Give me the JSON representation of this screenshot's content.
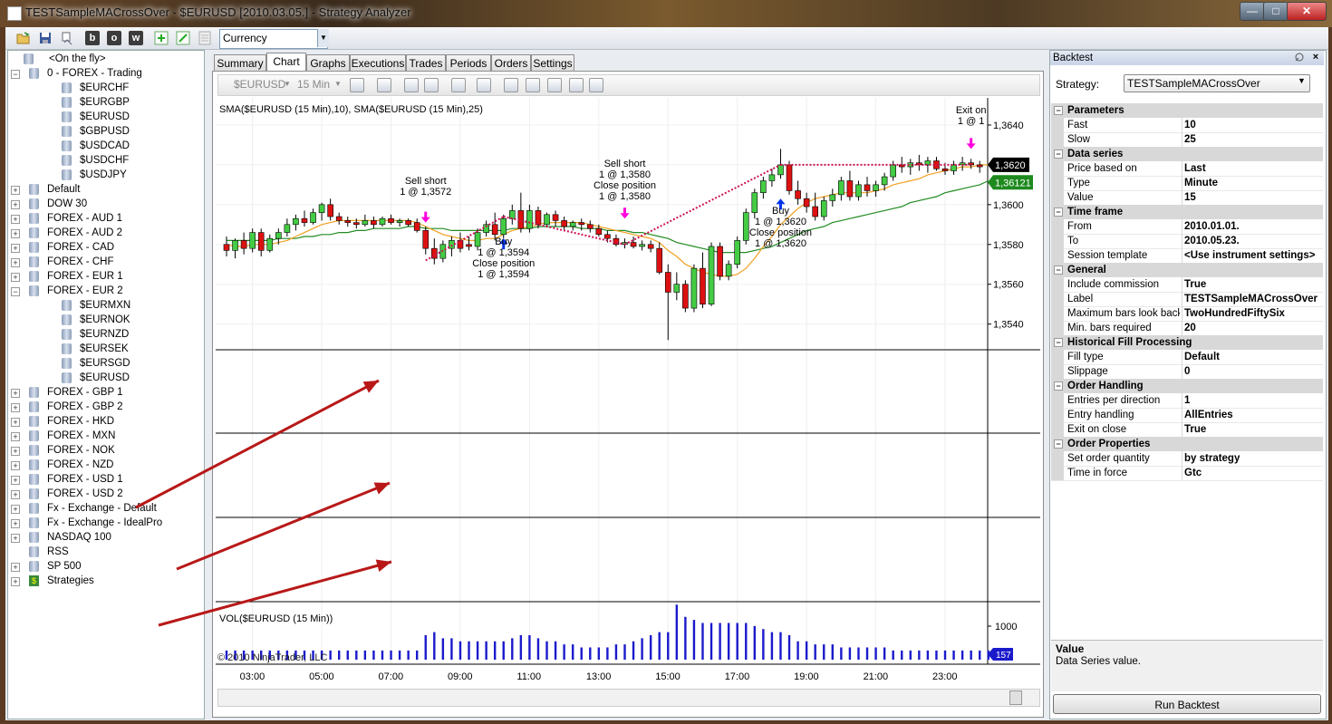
{
  "window": {
    "title": "TESTSampleMACrossOver - $EURUSD [2010.03.05.] - Strategy Analyzer",
    "min_glyph": "—",
    "max_glyph": "□",
    "close_glyph": "✕"
  },
  "toolbar": {
    "icons": [
      "folder-open-icon",
      "save-icon",
      "print-icon",
      "bold-b-icon",
      "bold-o-icon",
      "bold-w-icon",
      "add-icon",
      "edit-icon",
      "delete-icon"
    ],
    "letters": [
      "b",
      "o",
      "w"
    ],
    "currency_select": "Currency"
  },
  "tree": {
    "items": [
      {
        "label": "<On the fly>",
        "level": 1,
        "exp": ""
      },
      {
        "label": "0 - FOREX - Trading",
        "level": 0,
        "exp": "−"
      },
      {
        "label": "$EURCHF",
        "level": 2,
        "exp": ""
      },
      {
        "label": "$EURGBP",
        "level": 2,
        "exp": ""
      },
      {
        "label": "$EURUSD",
        "level": 2,
        "exp": ""
      },
      {
        "label": "$GBPUSD",
        "level": 2,
        "exp": ""
      },
      {
        "label": "$USDCAD",
        "level": 2,
        "exp": ""
      },
      {
        "label": "$USDCHF",
        "level": 2,
        "exp": ""
      },
      {
        "label": "$USDJPY",
        "level": 2,
        "exp": ""
      },
      {
        "label": "Default",
        "level": 0,
        "exp": "+"
      },
      {
        "label": "DOW 30",
        "level": 0,
        "exp": "+"
      },
      {
        "label": "FOREX - AUD 1",
        "level": 0,
        "exp": "+"
      },
      {
        "label": "FOREX - AUD 2",
        "level": 0,
        "exp": "+"
      },
      {
        "label": "FOREX - CAD",
        "level": 0,
        "exp": "+"
      },
      {
        "label": "FOREX - CHF",
        "level": 0,
        "exp": "+"
      },
      {
        "label": "FOREX - EUR 1",
        "level": 0,
        "exp": "+"
      },
      {
        "label": "FOREX - EUR 2",
        "level": 0,
        "exp": "−"
      },
      {
        "label": "$EURMXN",
        "level": 2,
        "exp": ""
      },
      {
        "label": "$EURNOK",
        "level": 2,
        "exp": ""
      },
      {
        "label": "$EURNZD",
        "level": 2,
        "exp": ""
      },
      {
        "label": "$EURSEK",
        "level": 2,
        "exp": ""
      },
      {
        "label": "$EURSGD",
        "level": 2,
        "exp": ""
      },
      {
        "label": "$EURUSD",
        "level": 2,
        "exp": ""
      },
      {
        "label": "FOREX - GBP 1",
        "level": 0,
        "exp": "+"
      },
      {
        "label": "FOREX - GBP 2",
        "level": 0,
        "exp": "+"
      },
      {
        "label": "FOREX - HKD",
        "level": 0,
        "exp": "+"
      },
      {
        "label": "FOREX - MXN",
        "level": 0,
        "exp": "+"
      },
      {
        "label": "FOREX - NOK",
        "level": 0,
        "exp": "+"
      },
      {
        "label": "FOREX - NZD",
        "level": 0,
        "exp": "+"
      },
      {
        "label": "FOREX - USD 1",
        "level": 0,
        "exp": "+"
      },
      {
        "label": "FOREX - USD 2",
        "level": 0,
        "exp": "+"
      },
      {
        "label": "Fx - Exchange - Default",
        "level": 0,
        "exp": "+"
      },
      {
        "label": "Fx - Exchange - IdealPro",
        "level": 0,
        "exp": "+"
      },
      {
        "label": "NASDAQ 100",
        "level": 0,
        "exp": "+"
      },
      {
        "label": "RSS",
        "level": 0,
        "exp": ""
      },
      {
        "label": "SP 500",
        "level": 0,
        "exp": "+"
      },
      {
        "label": "Strategies",
        "level": 0,
        "exp": "+",
        "icon": "strategy-icon"
      }
    ]
  },
  "tabs": [
    "Summary",
    "Chart",
    "Graphs",
    "Executions",
    "Trades",
    "Periods",
    "Orders",
    "Settings"
  ],
  "active_tab": "Chart",
  "chart": {
    "symbol": "$EURUSD",
    "interval": "15 Min",
    "indicator_label": "SMA($EURUSD (15 Min),10), SMA($EURUSD (15 Min),25)",
    "volume_label": "VOL($EURUSD (15 Min))",
    "copyright": "© 2010 NinjaTrader, LLC",
    "last_price_badge": "1,3620",
    "sma_badge": "1,36121",
    "volume_badge": "157",
    "volume_tick": "1000",
    "annotations": [
      {
        "lines": [
          "Sell short",
          "1 @ 1,3572"
        ]
      },
      {
        "lines": [
          "Buy",
          "1 @ 1,3594",
          "Close position",
          "1 @ 1,3594"
        ]
      },
      {
        "lines": [
          "Sell short",
          "1 @ 1,3580",
          "Close position",
          "1 @ 1,3580"
        ]
      },
      {
        "lines": [
          "Buy",
          "1 @ 1,3620",
          "Close position",
          "1 @ 1,3620"
        ]
      },
      {
        "lines": [
          "Exit on",
          "1 @ 1"
        ]
      }
    ]
  },
  "chart_data": {
    "type": "candlestick",
    "price_axis_ticks": [
      "1,3640",
      "1,3620",
      "1,3600",
      "1,3580",
      "1,3560",
      "1,3540"
    ],
    "ylim": [
      1.3528,
      1.365
    ],
    "time_ticks": [
      "03:00",
      "05:00",
      "07:00",
      "09:00",
      "11:00",
      "13:00",
      "15:00",
      "17:00",
      "19:00",
      "21:00",
      "23:00"
    ],
    "x_start": "02:15",
    "bar_interval_min": 15,
    "candles": [
      [
        1.358,
        1.3584,
        1.3574,
        1.3577
      ],
      [
        1.3577,
        1.3583,
        1.3573,
        1.3582
      ],
      [
        1.3582,
        1.3586,
        1.3575,
        1.3578
      ],
      [
        1.3578,
        1.3588,
        1.3576,
        1.3586
      ],
      [
        1.3586,
        1.3588,
        1.3574,
        1.3577
      ],
      [
        1.3577,
        1.3585,
        1.3576,
        1.3583
      ],
      [
        1.3583,
        1.3588,
        1.358,
        1.3586
      ],
      [
        1.3586,
        1.3593,
        1.3584,
        1.359
      ],
      [
        1.359,
        1.3595,
        1.3587,
        1.3593
      ],
      [
        1.3593,
        1.3597,
        1.3589,
        1.3591
      ],
      [
        1.3591,
        1.3598,
        1.359,
        1.3596
      ],
      [
        1.3596,
        1.3601,
        1.3592,
        1.36
      ],
      [
        1.36,
        1.3603,
        1.3592,
        1.3594
      ],
      [
        1.3594,
        1.3596,
        1.359,
        1.3592
      ],
      [
        1.3592,
        1.3594,
        1.3589,
        1.3591
      ],
      [
        1.3591,
        1.3593,
        1.3588,
        1.359
      ],
      [
        1.359,
        1.3595,
        1.3589,
        1.3592
      ],
      [
        1.3592,
        1.3594,
        1.3588,
        1.359
      ],
      [
        1.359,
        1.3594,
        1.3589,
        1.3593
      ],
      [
        1.3593,
        1.3595,
        1.359,
        1.3591
      ],
      [
        1.3591,
        1.3593,
        1.3589,
        1.3592
      ],
      [
        1.3592,
        1.3593,
        1.3589,
        1.359
      ],
      [
        1.3591,
        1.3593,
        1.3586,
        1.3587
      ],
      [
        1.3587,
        1.3589,
        1.3575,
        1.3578
      ],
      [
        1.3578,
        1.3583,
        1.357,
        1.3573
      ],
      [
        1.3573,
        1.3582,
        1.3571,
        1.358
      ],
      [
        1.3578,
        1.3584,
        1.3574,
        1.3582
      ],
      [
        1.3582,
        1.3586,
        1.3576,
        1.3578
      ],
      [
        1.358,
        1.3584,
        1.3577,
        1.3579
      ],
      [
        1.3579,
        1.3588,
        1.3577,
        1.3586
      ],
      [
        1.3586,
        1.3592,
        1.3584,
        1.359
      ],
      [
        1.359,
        1.3596,
        1.3582,
        1.3585
      ],
      [
        1.3585,
        1.3595,
        1.3583,
        1.3593
      ],
      [
        1.3593,
        1.36,
        1.359,
        1.3597
      ],
      [
        1.3597,
        1.3606,
        1.3586,
        1.3588
      ],
      [
        1.3588,
        1.36,
        1.3586,
        1.3597
      ],
      [
        1.3597,
        1.3599,
        1.3588,
        1.359
      ],
      [
        1.359,
        1.3596,
        1.3589,
        1.3595
      ],
      [
        1.3595,
        1.3597,
        1.3589,
        1.3592
      ],
      [
        1.3592,
        1.3594,
        1.3587,
        1.3589
      ],
      [
        1.3589,
        1.3592,
        1.3587,
        1.3591
      ],
      [
        1.3591,
        1.3593,
        1.3587,
        1.359
      ],
      [
        1.359,
        1.3592,
        1.3586,
        1.3588
      ],
      [
        1.3588,
        1.359,
        1.3584,
        1.3585
      ],
      [
        1.3585,
        1.3587,
        1.3581,
        1.3583
      ],
      [
        1.3583,
        1.3585,
        1.3579,
        1.358
      ],
      [
        1.358,
        1.3583,
        1.3578,
        1.3581
      ],
      [
        1.3581,
        1.3584,
        1.3578,
        1.3579
      ],
      [
        1.3579,
        1.3582,
        1.3577,
        1.358
      ],
      [
        1.358,
        1.3582,
        1.3576,
        1.3578
      ],
      [
        1.3578,
        1.3581,
        1.3565,
        1.3566
      ],
      [
        1.3566,
        1.357,
        1.3532,
        1.3556
      ],
      [
        1.3556,
        1.3566,
        1.3552,
        1.356
      ],
      [
        1.356,
        1.3562,
        1.3546,
        1.3548
      ],
      [
        1.3548,
        1.357,
        1.3546,
        1.3568
      ],
      [
        1.3568,
        1.3576,
        1.3548,
        1.355
      ],
      [
        1.355,
        1.3581,
        1.3549,
        1.3579
      ],
      [
        1.3579,
        1.3581,
        1.3562,
        1.3564
      ],
      [
        1.3564,
        1.3572,
        1.3562,
        1.357
      ],
      [
        1.357,
        1.3584,
        1.3568,
        1.3582
      ],
      [
        1.3582,
        1.3598,
        1.358,
        1.3596
      ],
      [
        1.3596,
        1.3608,
        1.3593,
        1.3606
      ],
      [
        1.3606,
        1.3614,
        1.3603,
        1.3612
      ],
      [
        1.3612,
        1.3618,
        1.3609,
        1.3615
      ],
      [
        1.3615,
        1.3628,
        1.3613,
        1.362
      ],
      [
        1.362,
        1.3622,
        1.3605,
        1.3607
      ],
      [
        1.3607,
        1.3612,
        1.36,
        1.3603
      ],
      [
        1.3603,
        1.3606,
        1.3596,
        1.3599
      ],
      [
        1.3599,
        1.3606,
        1.3592,
        1.3594
      ],
      [
        1.3594,
        1.3604,
        1.3592,
        1.3602
      ],
      [
        1.3602,
        1.3608,
        1.3599,
        1.3605
      ],
      [
        1.3605,
        1.3614,
        1.3602,
        1.3612
      ],
      [
        1.3612,
        1.3617,
        1.3602,
        1.3604
      ],
      [
        1.3604,
        1.3612,
        1.3602,
        1.361
      ],
      [
        1.361,
        1.3614,
        1.3604,
        1.3607
      ],
      [
        1.3607,
        1.3612,
        1.3604,
        1.361
      ],
      [
        1.361,
        1.3616,
        1.3607,
        1.3614
      ],
      [
        1.3614,
        1.3622,
        1.3612,
        1.362
      ],
      [
        1.362,
        1.3624,
        1.3616,
        1.3619
      ],
      [
        1.3619,
        1.3623,
        1.3615,
        1.3621
      ],
      [
        1.3621,
        1.3625,
        1.3617,
        1.362
      ],
      [
        1.362,
        1.3624,
        1.3616,
        1.3622
      ],
      [
        1.3622,
        1.3624,
        1.3617,
        1.3618
      ],
      [
        1.3618,
        1.3621,
        1.3615,
        1.3617
      ],
      [
        1.3617,
        1.3622,
        1.3615,
        1.362
      ],
      [
        1.362,
        1.3624,
        1.3617,
        1.3621
      ],
      [
        1.3621,
        1.3623,
        1.3618,
        1.362
      ],
      [
        1.362,
        1.3622,
        1.3616,
        1.3619
      ]
    ],
    "sma_fast": [
      1.358,
      1.3579,
      1.3579,
      1.358,
      1.358,
      1.358,
      1.3581,
      1.3582,
      1.3584,
      1.3586,
      1.3588,
      1.359,
      1.3591,
      1.3592,
      1.3592,
      1.3592,
      1.3592,
      1.3592,
      1.3592,
      1.3592,
      1.3592,
      1.3592,
      1.3591,
      1.3589,
      1.3587,
      1.3585,
      1.3584,
      1.3583,
      1.3582,
      1.3582,
      1.3583,
      1.3583,
      1.3585,
      1.3587,
      1.3588,
      1.3589,
      1.359,
      1.3591,
      1.3591,
      1.3591,
      1.3591,
      1.3591,
      1.359,
      1.3589,
      1.3588,
      1.3587,
      1.3586,
      1.3585,
      1.3584,
      1.3583,
      1.3581,
      1.3577,
      1.3574,
      1.357,
      1.3568,
      1.3566,
      1.3565,
      1.3564,
      1.3564,
      1.3565,
      1.3568,
      1.3573,
      1.3579,
      1.3584,
      1.359,
      1.3594,
      1.3598,
      1.3601,
      1.3603,
      1.3604,
      1.3605,
      1.3606,
      1.3606,
      1.3606,
      1.3606,
      1.3607,
      1.3608,
      1.361,
      1.3611,
      1.3612,
      1.3613,
      1.3615,
      1.3616,
      1.3617,
      1.3618,
      1.3619,
      1.3619,
      1.362,
      1.362
    ],
    "sma_slow": [
      1.3582,
      1.3582,
      1.3582,
      1.3582,
      1.3582,
      1.3582,
      1.3583,
      1.3583,
      1.3583,
      1.3584,
      1.3584,
      1.3585,
      1.3585,
      1.3586,
      1.3586,
      1.3587,
      1.3587,
      1.3588,
      1.3588,
      1.3588,
      1.3588,
      1.3589,
      1.3589,
      1.3588,
      1.3588,
      1.3588,
      1.3587,
      1.3587,
      1.3587,
      1.3587,
      1.3587,
      1.3587,
      1.3587,
      1.3588,
      1.3588,
      1.3588,
      1.3589,
      1.3589,
      1.3589,
      1.3589,
      1.3589,
      1.3588,
      1.3588,
      1.3588,
      1.3587,
      1.3587,
      1.3587,
      1.3586,
      1.3586,
      1.3585,
      1.3584,
      1.3583,
      1.3581,
      1.358,
      1.3579,
      1.3578,
      1.3577,
      1.3576,
      1.3576,
      1.3576,
      1.3576,
      1.3577,
      1.3578,
      1.3579,
      1.3581,
      1.3583,
      1.3585,
      1.3587,
      1.3588,
      1.3589,
      1.3591,
      1.3592,
      1.3593,
      1.3594,
      1.3595,
      1.3596,
      1.3597,
      1.3598,
      1.3599,
      1.3601,
      1.3602,
      1.3603,
      1.3604,
      1.3606,
      1.3607,
      1.3608,
      1.3609,
      1.361,
      1.3612
    ],
    "volume": [
      3,
      3,
      3,
      3,
      3,
      3,
      3,
      3,
      3,
      3,
      3,
      3,
      3,
      3,
      3,
      3,
      3,
      3,
      3,
      3,
      3,
      3,
      3,
      8,
      9,
      7,
      7,
      6,
      6,
      6,
      6,
      6,
      6,
      7,
      8,
      8,
      7,
      6,
      6,
      5,
      5,
      4,
      4,
      4,
      4,
      5,
      5,
      6,
      7,
      8,
      9,
      9,
      18,
      14,
      13,
      12,
      12,
      12,
      12,
      12,
      12,
      11,
      10,
      9,
      9,
      8,
      6,
      6,
      5,
      5,
      5,
      4,
      4,
      4,
      4,
      4,
      4,
      3,
      3,
      3,
      3,
      3,
      3,
      3,
      3,
      3,
      3,
      3,
      3,
      3
    ],
    "volume_axis_max": 1000
  },
  "backtest": {
    "panel_title": "Backtest",
    "strategy_label": "Strategy:",
    "strategy_value": "TESTSampleMACrossOver",
    "grid": [
      {
        "cat": "Parameters",
        "rows": [
          [
            "Fast",
            "10"
          ],
          [
            "Slow",
            "25"
          ]
        ]
      },
      {
        "cat": "Data series",
        "rows": [
          [
            "Price based on",
            "Last"
          ],
          [
            "Type",
            "Minute"
          ],
          [
            "Value",
            "15"
          ]
        ]
      },
      {
        "cat": "Time frame",
        "rows": [
          [
            "From",
            "2010.01.01."
          ],
          [
            "To",
            "2010.05.23."
          ],
          [
            "Session template",
            "<Use instrument settings>"
          ]
        ]
      },
      {
        "cat": "General",
        "rows": [
          [
            "Include commission",
            "True"
          ],
          [
            "Label",
            "TESTSampleMACrossOver"
          ],
          [
            "Maximum bars look back",
            "TwoHundredFiftySix"
          ],
          [
            "Min. bars required",
            "20"
          ]
        ]
      },
      {
        "cat": "Historical Fill Processing",
        "rows": [
          [
            "Fill type",
            "Default"
          ],
          [
            "Slippage",
            "0"
          ]
        ]
      },
      {
        "cat": "Order Handling",
        "rows": [
          [
            "Entries per direction",
            "1"
          ],
          [
            "Entry handling",
            "AllEntries"
          ],
          [
            "Exit on close",
            "True"
          ]
        ]
      },
      {
        "cat": "Order Properties",
        "rows": [
          [
            "Set order quantity",
            "by strategy"
          ],
          [
            "Time in force",
            "Gtc"
          ]
        ]
      }
    ],
    "desc_title": "Value",
    "desc_text": "Data Series value.",
    "run_button": "Run Backtest"
  },
  "colors": {
    "up_candle": "#44cc44",
    "down_candle": "#dd1111",
    "sma_fast": "#f0a020",
    "sma_slow": "#228b22",
    "volume": "#1a1acc",
    "trade_line": "#cc1155",
    "marker": "#ff00dd",
    "buy_arrow": "#0033ee",
    "arrow_annotation": "#b81818"
  }
}
